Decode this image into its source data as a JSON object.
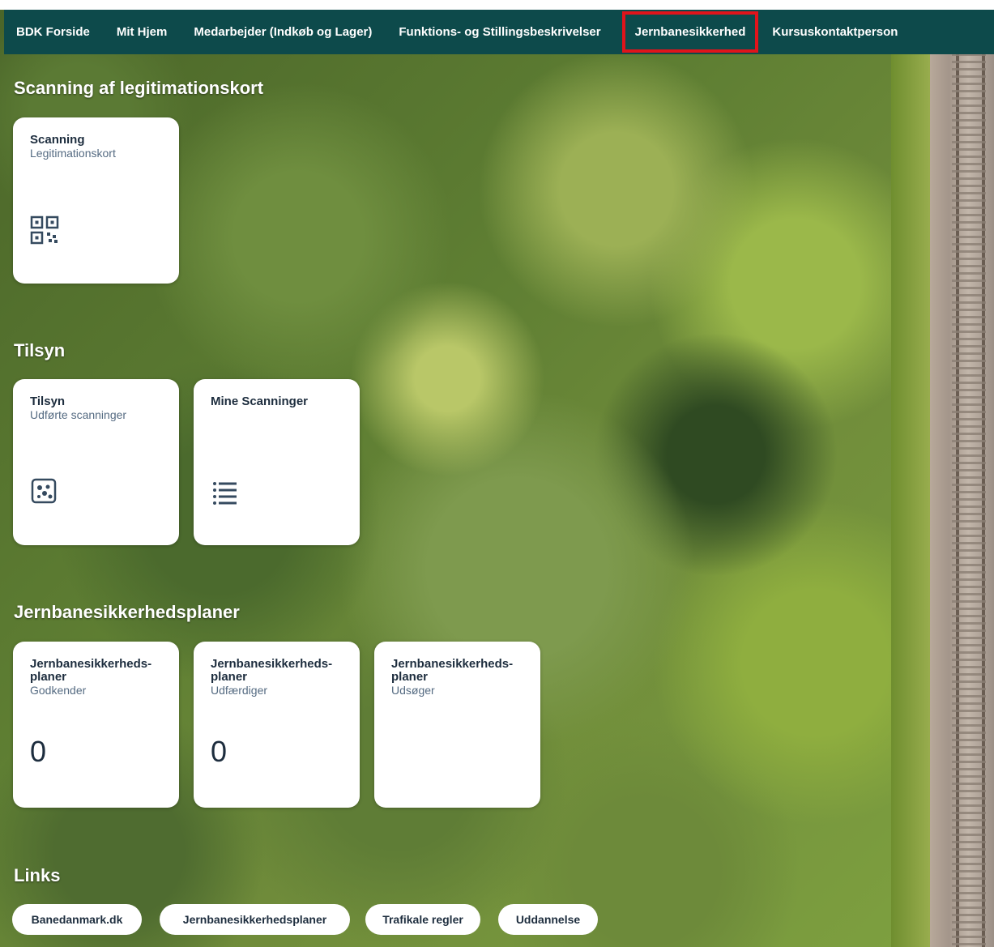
{
  "nav": {
    "items": [
      {
        "label": "BDK Forside"
      },
      {
        "label": "Mit Hjem"
      },
      {
        "label": "Medarbejder (Indkøb og Lager)"
      },
      {
        "label": "Funktions- og Stillingsbeskrivelser"
      },
      {
        "label": "Jernbanesikkerhed",
        "active": true
      },
      {
        "label": "Kursuskontaktperson"
      }
    ],
    "background_color": "#0d4a4b",
    "active_outline_color": "#e0141b"
  },
  "sections": {
    "scanning": {
      "title": "Scanning af legitimationskort",
      "tiles": [
        {
          "title": "Scanning",
          "subtitle": "Legitimationskort",
          "icon": "qr-code-icon"
        }
      ]
    },
    "tilsyn": {
      "title": "Tilsyn",
      "tiles": [
        {
          "title": "Tilsyn",
          "subtitle": "Udførte scanninger",
          "icon": "inspection-icon"
        },
        {
          "title": "Mine Scanninger",
          "subtitle": "",
          "icon": "list-icon"
        }
      ]
    },
    "planer": {
      "title": "Jernbanesikkerhedsplaner",
      "tiles": [
        {
          "title": "Jernbanesikkerheds-planer",
          "subtitle": "Godkender",
          "value": "0"
        },
        {
          "title": "Jernbanesikkerheds-planer",
          "subtitle": "Udfærdiger",
          "value": "0"
        },
        {
          "title": "Jernbanesikkerheds-planer",
          "subtitle": "Udsøger",
          "value": ""
        }
      ]
    },
    "links": {
      "title": "Links",
      "items": [
        {
          "label": "Banedanmark.dk"
        },
        {
          "label": "Jernbanesikkerhedsplaner"
        },
        {
          "label": "Trafikale regler"
        },
        {
          "label": "Uddannelse"
        }
      ]
    }
  }
}
